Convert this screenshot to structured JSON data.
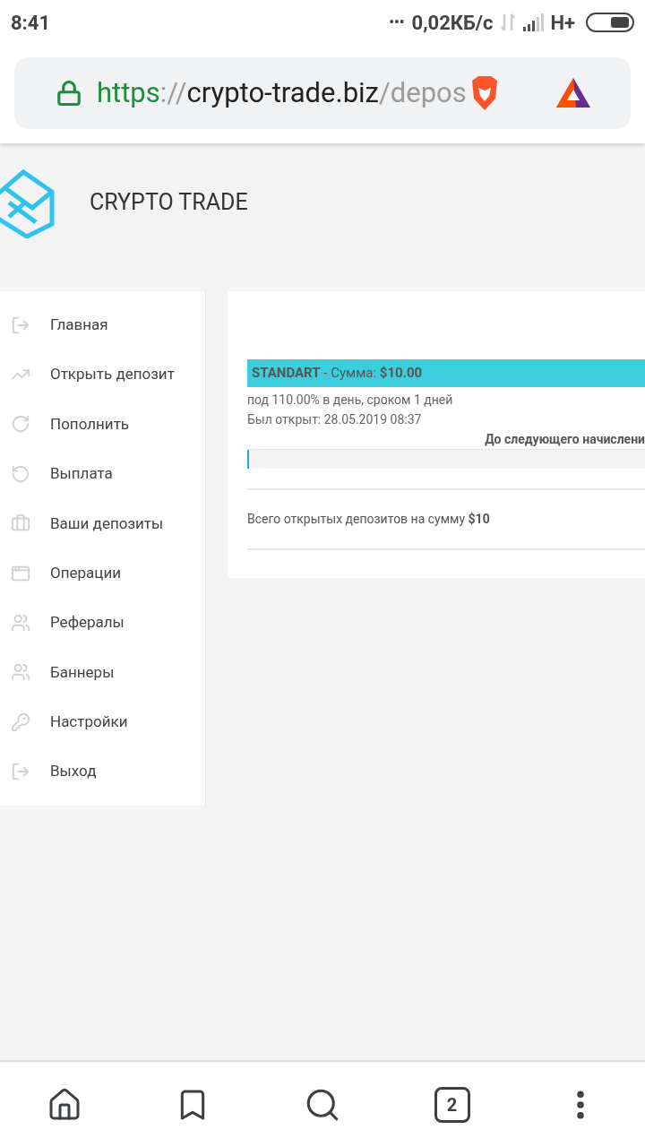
{
  "status_bar": {
    "time": "8:41",
    "dots": "•••",
    "speed": "0,02КБ/с",
    "network": "H+"
  },
  "address_bar": {
    "url_parts": [
      {
        "kind": "scheme",
        "text": "https"
      },
      {
        "kind": "separator",
        "text": "://"
      },
      {
        "kind": "host",
        "text": "crypto-trade.biz"
      },
      {
        "kind": "path",
        "text": "/depos"
      }
    ]
  },
  "site_header": {
    "title": "CRYPTO TRADE"
  },
  "sidebar": {
    "items": [
      {
        "label": "Главная"
      },
      {
        "label": "Открыть депозит"
      },
      {
        "label": "Пополнить"
      },
      {
        "label": "Выплата"
      },
      {
        "label": "Ваши депозиты"
      },
      {
        "label": "Операции"
      },
      {
        "label": "Рефералы"
      },
      {
        "label": "Баннеры"
      },
      {
        "label": "Настройки"
      },
      {
        "label": "Выход"
      }
    ]
  },
  "deposit": {
    "title": "**STANDART** - Сумма: **$10.00**",
    "terms": "под 110.00% в день, сроком 1 дней",
    "opened": "Был открыт: 28.05.2019 08:37",
    "next_accrual": "До следующего начислени",
    "level": 0.005
  },
  "total": "Всего открытых депозитов на сумму **$10**",
  "bottom_nav": {
    "tab_count": "2"
  }
}
